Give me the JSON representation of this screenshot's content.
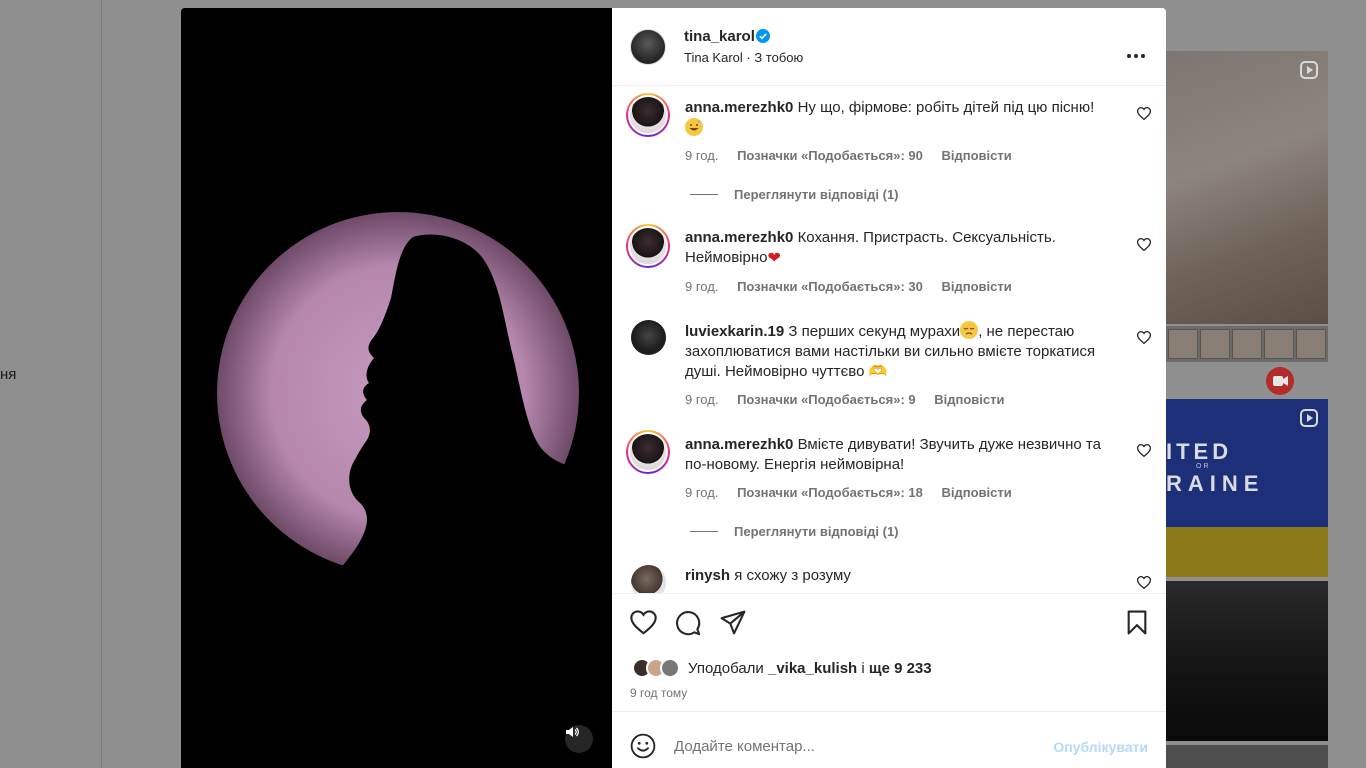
{
  "background": {
    "left_text": "ня",
    "tile_text_line1": "ITED",
    "tile_text_small": "OR",
    "tile_text_line2": "RAINE"
  },
  "post": {
    "owner": {
      "username": "tina_karol",
      "subtitle": "Tina Karol · З тобою",
      "verified": true
    },
    "comments": [
      {
        "username": "anna.merezhk0",
        "text": "Ну що, фірмове: робіть дітей під цю пісню!",
        "emoji": "grinning-sweat-emoji",
        "time": "9 год.",
        "likes": "Позначки «Подобається»: 90",
        "reply": "Відповісти",
        "view_replies": "Переглянути відповіді (1)"
      },
      {
        "username": "anna.merezhk0",
        "text": "Кохання. Пристрасть. Сексуальність. Неймовірно",
        "emoji": "red-heart-emoji",
        "time": "9 год.",
        "likes": "Позначки «Подобається»: 30",
        "reply": "Відповісти"
      },
      {
        "username": "luviexkarin.19",
        "text_part1": "З перших секунд мурахи",
        "text_part2": ", не перестаю захоплюватися вами настільки ви сильно вмієте торкатися душі. Неймовірно чуттєво 🫶",
        "emoji": "pensive-face-emoji",
        "time": "9 год.",
        "likes": "Позначки «Подобається»: 9",
        "reply": "Відповісти"
      },
      {
        "username": "anna.merezhk0",
        "text": "Вмієте дивувати! Звучить дуже незвично та по-новому. Енергія неймовірна!",
        "time": "9 год.",
        "likes": "Позначки «Подобається»: 18",
        "reply": "Відповісти",
        "view_replies": "Переглянути відповіді (1)"
      },
      {
        "username": "rinysh",
        "text": "я схожу з розуму"
      }
    ],
    "liked_by_prefix": "Уподобали",
    "liked_by_user": "_vika_kulish",
    "liked_by_suffix": "і",
    "liked_by_count": "ще 9 233",
    "posted_ago": "9 год тому",
    "comment_placeholder": "Додайте коментар...",
    "publish_label": "Опублікувати"
  },
  "colors": {
    "spotlight": "#b98bb0",
    "verified_blue": "#0095f6",
    "publish_disabled": "#b7d9f8"
  }
}
